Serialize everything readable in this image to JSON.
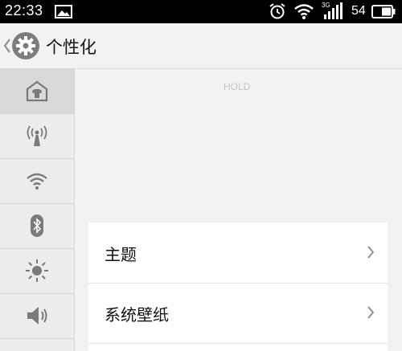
{
  "status_bar": {
    "time": "22:33",
    "network_type": "3G",
    "battery_level": "54",
    "icons": [
      "image-icon",
      "alarm-icon",
      "wifi-icon",
      "signal-icon",
      "battery-icon"
    ]
  },
  "header": {
    "title": "个性化",
    "icon": "gear-icon"
  },
  "sidebar": {
    "items": [
      {
        "icon": "home-icon",
        "active": true
      },
      {
        "icon": "antenna-icon",
        "active": false
      },
      {
        "icon": "wifi-icon",
        "active": false
      },
      {
        "icon": "bluetooth-icon",
        "active": false
      },
      {
        "icon": "brightness-icon",
        "active": false
      },
      {
        "icon": "volume-icon",
        "active": false
      }
    ]
  },
  "main": {
    "hold_text": "HOLD",
    "rows": [
      {
        "label": "主题"
      },
      {
        "label": "系统壁纸"
      }
    ]
  },
  "colors": {
    "status_bar": "#000000",
    "background": "#f2f2f2",
    "sidebar": "#ececec",
    "sidebar_active": "#d9d9d9",
    "icon": "#7a7a7a",
    "card": "#ffffff"
  }
}
